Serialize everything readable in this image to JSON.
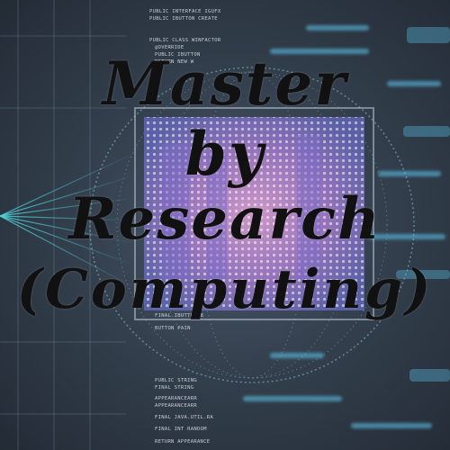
{
  "title": {
    "line1": "Master",
    "line2": "by",
    "line3": "Research",
    "line4": "(Computing)"
  },
  "background_code": [
    "PUBLIC INTERFACE IGUFX",
    "PUBLIC IBUTTON CREATE",
    "PUBLIC CLASS WINFACTOR",
    "@OVERRIDE",
    "PUBLIC IBUTTON",
    "RETURN NEW W",
    "FINAL IBUTTON B",
    "BUTTON PAIN",
    "PUBLIC STRING",
    "FINAL STRING",
    "APPEARANCEARR",
    "APPEARANCEARR",
    "FINAL JAVA.UTIL.RA",
    "FINAL INT RANDOM",
    "RETURN APPEARANCE"
  ],
  "colors": {
    "accent_cyan": "#5fc8f0",
    "chip_pink": "#d98ac8",
    "chip_purple": "#8a6fd0",
    "title_text": "#111111",
    "background": "#34404e"
  }
}
